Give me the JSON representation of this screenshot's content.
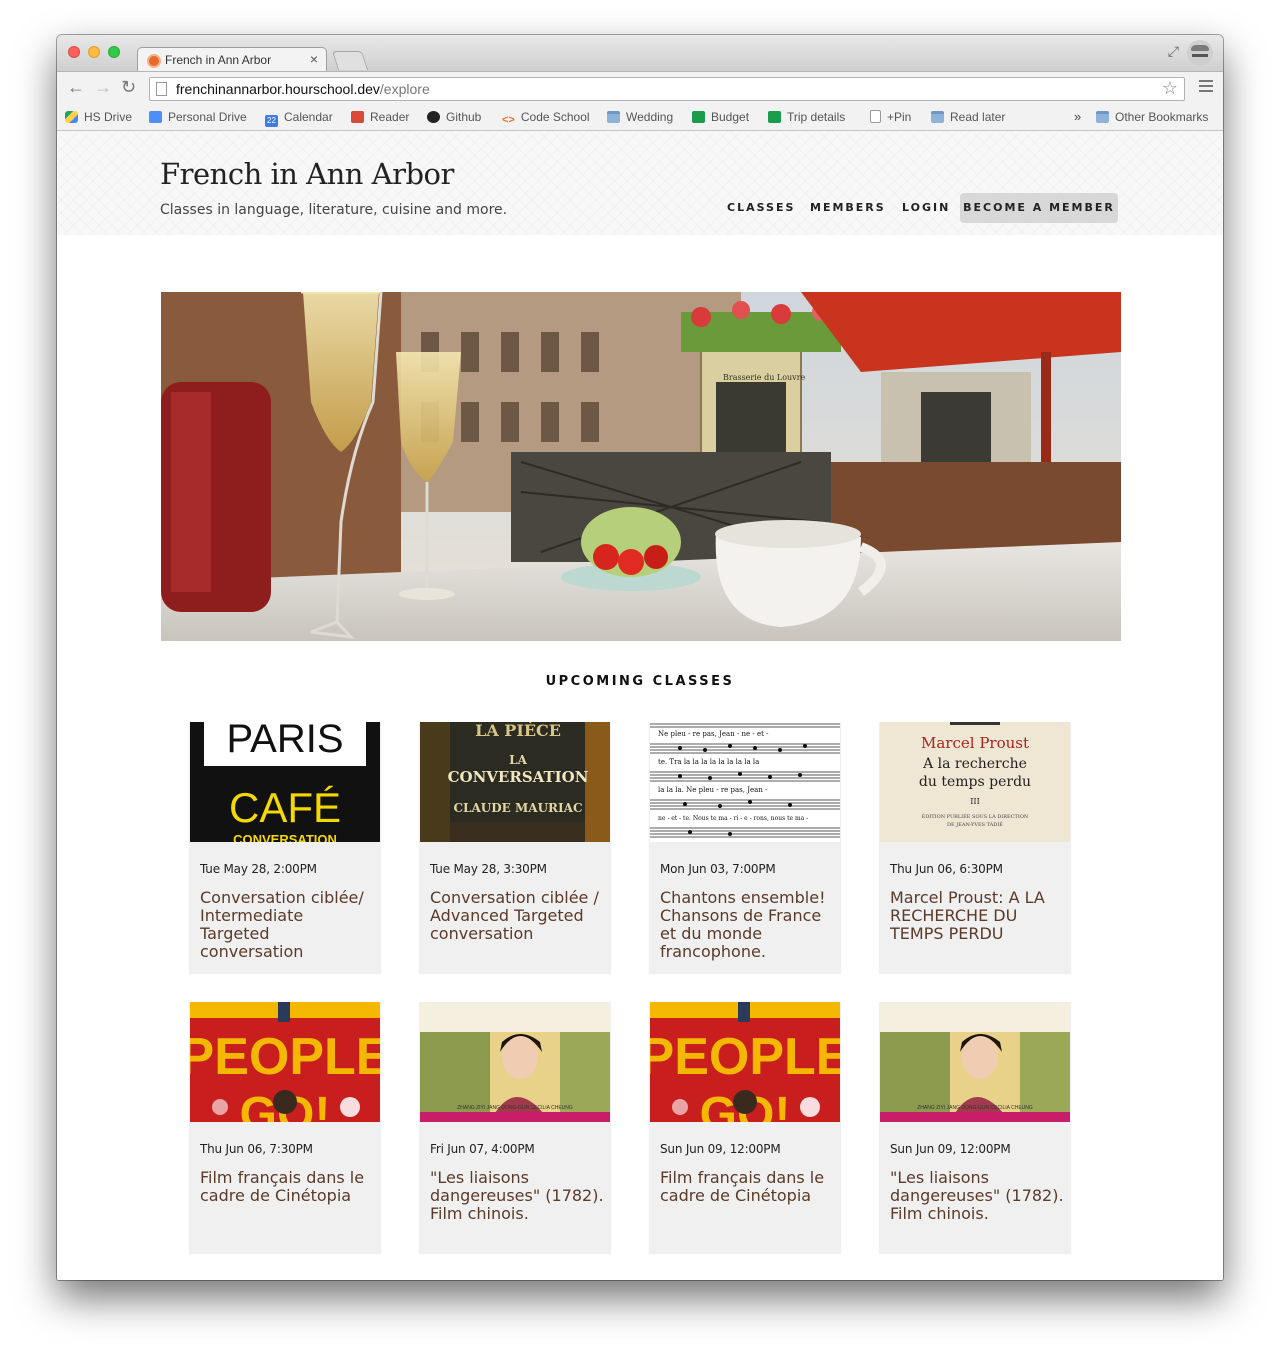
{
  "browser": {
    "tab_title": "French in Ann Arbor",
    "url_host": "frenchinannarbor.hourschool.dev",
    "url_path": "/explore",
    "bookmarks": [
      {
        "label": "HS Drive",
        "icon": "drive-icon"
      },
      {
        "label": "Personal Drive",
        "icon": "document-icon"
      },
      {
        "label": "Calendar",
        "icon": "calendar-icon",
        "badge": "22"
      },
      {
        "label": "Reader",
        "icon": "reader-icon"
      },
      {
        "label": "Github",
        "icon": "github-icon"
      },
      {
        "label": "Code School",
        "icon": "code-icon"
      },
      {
        "label": "Wedding",
        "icon": "folder-icon"
      },
      {
        "label": "Budget",
        "icon": "spreadsheet-icon"
      },
      {
        "label": "Trip details",
        "icon": "spreadsheet-icon"
      },
      {
        "label": "+Pin",
        "icon": "page-icon"
      },
      {
        "label": "Read later",
        "icon": "folder-icon"
      }
    ],
    "overflow_label": "»",
    "other_bookmarks": "Other Bookmarks"
  },
  "site": {
    "title": "French in Ann Arbor",
    "tagline": "Classes in language, literature, cuisine and more.",
    "nav": {
      "classes": "CLASSES",
      "members": "MEMBERS",
      "login": "LOGIN",
      "become_member": "BECOME A MEMBER"
    }
  },
  "hero": {
    "sign_text": "Brasserie du Louvre"
  },
  "upcoming": {
    "heading": "UPCOMING CLASSES",
    "classes": [
      {
        "date": "Tue May 28, 2:00PM",
        "title": "Conversation ciblée/ Intermediate Targeted conversation",
        "thumb": "paris-cafe"
      },
      {
        "date": "Tue May 28, 3:30PM",
        "title": "Conversation ciblée / Advanced Targeted conversation",
        "thumb": "book-conversation"
      },
      {
        "date": "Mon Jun 03, 7:00PM",
        "title": "Chantons ensemble! Chansons de France et du monde francophone.",
        "thumb": "sheet-music"
      },
      {
        "date": "Thu Jun 06, 6:30PM",
        "title": "Marcel Proust: A LA RECHERCHE DU TEMPS PERDU",
        "thumb": "proust-book"
      },
      {
        "date": "Thu Jun 06, 7:30PM",
        "title": "Film français dans le cadre de Cinétopia",
        "thumb": "people-poster"
      },
      {
        "date": "Fri Jun 07, 4:00PM",
        "title": "\"Les liaisons dangereuses\" (1782). Film chinois.",
        "thumb": "film-still"
      },
      {
        "date": "Sun Jun 09, 12:00PM",
        "title": "Film français dans le cadre de Cinétopia",
        "thumb": "people-poster"
      },
      {
        "date": "Sun Jun 09, 12:00PM",
        "title": "\"Les liaisons dangereuses\" (1782). Film chinois.",
        "thumb": "film-still"
      }
    ]
  },
  "thumbs": {
    "paris_top": "PARIS",
    "paris_cafe": "CAFÉ",
    "paris_sub": "CONVERSATION",
    "book_top": "LA PIÈCE",
    "book_la": "LA",
    "book_conv": "CONVERSATION",
    "book_author": "CLAUDE MAURIAC",
    "music_line1": "Ne  pleu - re  pas,   Jean - ne - et -",
    "music_line2": "te.    Tra    la  la  la  la  la  la  la  la  la",
    "music_line3": "la    la  la.    Ne   pleu - re  pas,   Jean -",
    "music_line4": "ne - et - te.    Nous  te  ma - ri - e - rons, nous te ma -",
    "proust_author": "Marcel Proust",
    "proust_title1": "A la recherche",
    "proust_title2": "du temps perdu",
    "proust_vol": "III",
    "proust_small1": "ÉDITION PUBLIÉE SOUS LA DIRECTION",
    "proust_small2": "DE JEAN-YVES TADIÉ",
    "poster_word": "PEOPLE",
    "poster_word2": "GO!",
    "still_credits": "ZHANG ZIYI     JANG DONG-GUN     CECILIA CHEUNG"
  },
  "colors": {
    "title_text": "#5a3a28",
    "card_bg": "#f0f0f0",
    "nav_button_bg": "#d8d8d8",
    "poster_yellow": "#f5b800",
    "poster_red": "#c81e1e"
  }
}
